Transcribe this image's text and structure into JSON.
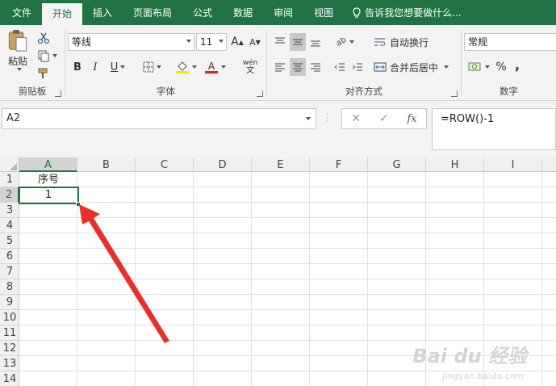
{
  "tabs": [
    {
      "label": "文件",
      "active": false
    },
    {
      "label": "开始",
      "active": true
    },
    {
      "label": "插入",
      "active": false
    },
    {
      "label": "页面布局",
      "active": false
    },
    {
      "label": "公式",
      "active": false
    },
    {
      "label": "数据",
      "active": false
    },
    {
      "label": "审阅",
      "active": false
    },
    {
      "label": "视图",
      "active": false
    }
  ],
  "tell_me": "告诉我您想要做什么...",
  "ribbon": {
    "clipboard": {
      "paste_label": "粘贴",
      "group_label": "剪贴板"
    },
    "font": {
      "font_name": "等线",
      "font_size": "11",
      "group_label": "字体",
      "bold": "B",
      "italic": "I",
      "underline": "U",
      "grow": "A",
      "shrink": "A",
      "phonetic": "wén"
    },
    "alignment": {
      "wrap_text": "自动换行",
      "merge_center": "合并后居中",
      "group_label": "对齐方式"
    },
    "number": {
      "format": "常规",
      "percent": "%",
      "comma": ",",
      "group_label": "数字"
    }
  },
  "formula_bar": {
    "name_box": "A2",
    "cancel": "✕",
    "enter": "✓",
    "fx": "fx",
    "formula": "=ROW()-1"
  },
  "grid": {
    "columns": [
      "A",
      "B",
      "C",
      "D",
      "E",
      "F",
      "G",
      "H",
      "I"
    ],
    "rows": [
      "1",
      "2",
      "3",
      "4",
      "5",
      "6",
      "7",
      "8",
      "9",
      "10",
      "11",
      "12",
      "13",
      "14"
    ],
    "selected_cell": "A2",
    "cells": [
      {
        "ref": "A1",
        "value": "序号"
      },
      {
        "ref": "A2",
        "value": "1"
      }
    ]
  },
  "watermark": {
    "text": "Bai du 经验",
    "url": "jingyan.baidu.com"
  },
  "accent_color": "#217346",
  "arrow_color": "#e8302a"
}
